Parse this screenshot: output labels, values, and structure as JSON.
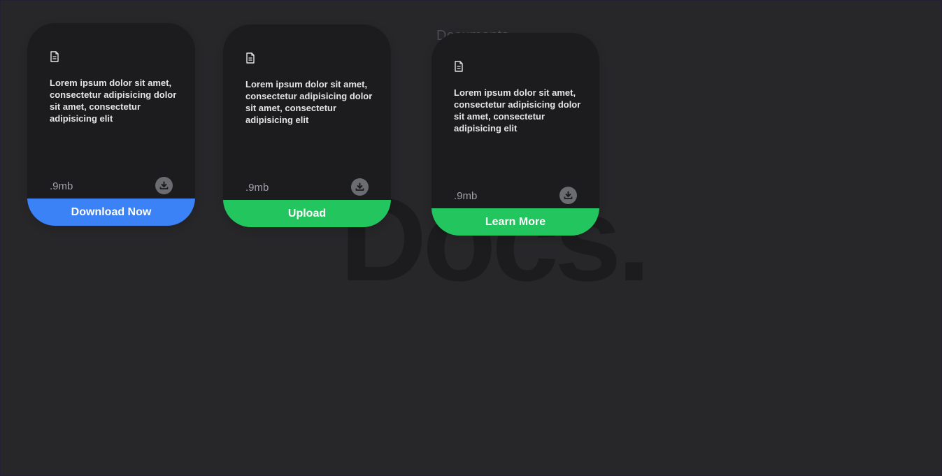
{
  "background": {
    "small_title": "Documents",
    "big_title": "Docs."
  },
  "colors": {
    "page_bg": "#27272a",
    "card_bg": "#1c1c1e",
    "blue_button": "#3b82f6",
    "green_button": "#22c55e"
  },
  "cards": [
    {
      "icon": "file-icon",
      "text": "Lorem ipsum dolor sit amet, consectetur adipisicing dolor sit amet, consectetur adipisicing elit",
      "size": ".9mb",
      "download_icon": "download-icon",
      "button_label": "Download Now",
      "button_color": "#3b82f6"
    },
    {
      "icon": "file-icon",
      "text": "Lorem ipsum dolor sit amet, consectetur adipisicing dolor sit amet, consectetur adipisicing elit",
      "size": ".9mb",
      "download_icon": "download-icon",
      "button_label": "Upload",
      "button_color": "#22c55e"
    },
    {
      "icon": "file-icon",
      "text": "Lorem ipsum dolor sit amet, consectetur adipisicing dolor sit amet, consectetur adipisicing elit",
      "size": ".9mb",
      "download_icon": "download-icon",
      "button_label": "Learn More",
      "button_color": "#22c55e"
    }
  ]
}
